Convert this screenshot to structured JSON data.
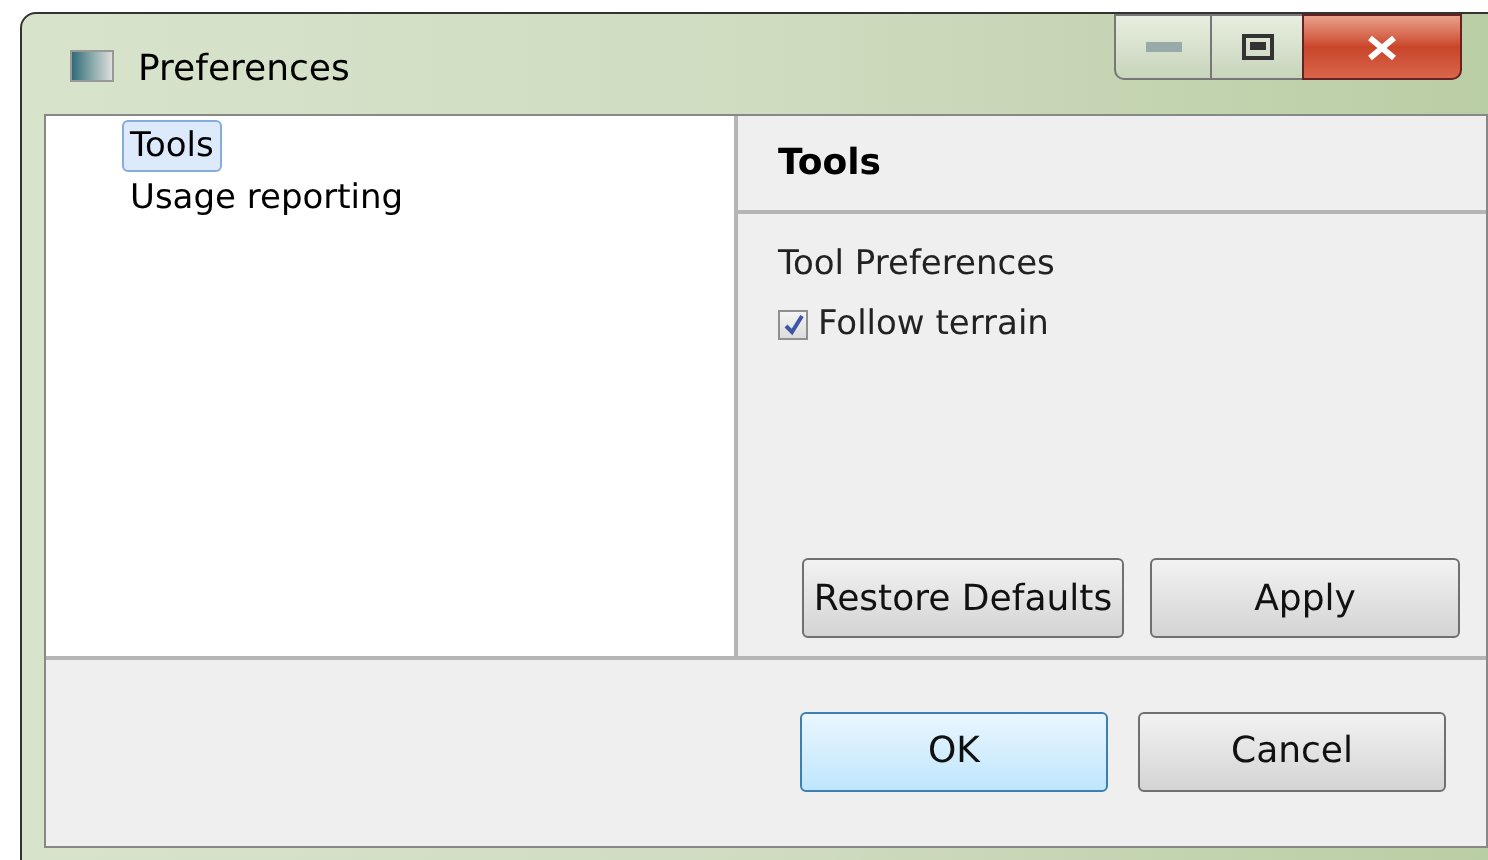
{
  "window": {
    "title": "Preferences"
  },
  "sidebar": {
    "items": [
      {
        "label": "Tools",
        "selected": true
      },
      {
        "label": "Usage reporting",
        "selected": false
      }
    ]
  },
  "page": {
    "title": "Tools",
    "group": "Tool Preferences",
    "options": [
      {
        "label": "Follow terrain",
        "checked": true
      }
    ],
    "buttons": [
      "Restore Defaults",
      "Apply"
    ]
  },
  "footer": {
    "buttons": [
      {
        "label": "OK",
        "default": true
      },
      {
        "label": "Cancel",
        "default": false
      }
    ]
  }
}
